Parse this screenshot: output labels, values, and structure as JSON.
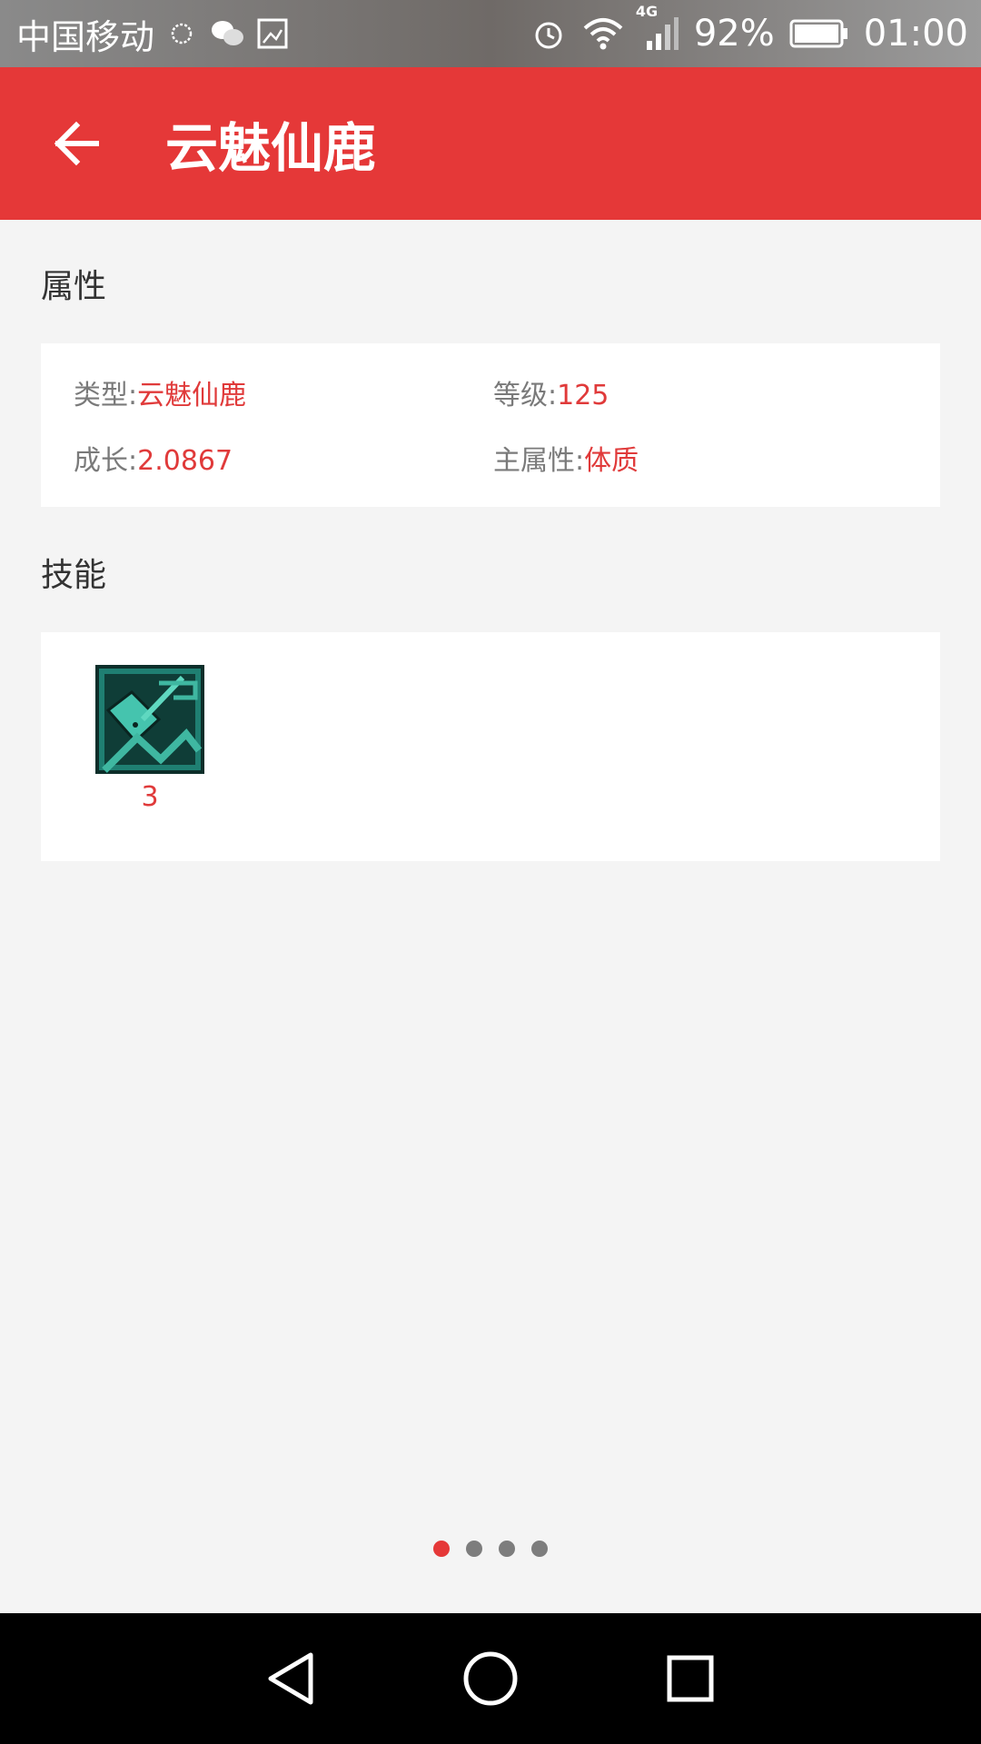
{
  "status_bar": {
    "carrier": "中国移动",
    "network": "4G",
    "battery": "92%",
    "time": "01:00"
  },
  "appbar": {
    "title": "云魅仙鹿"
  },
  "attributes": {
    "section_title": "属性",
    "type_label": "类型:",
    "type_value": "云魅仙鹿",
    "level_label": "等级:",
    "level_value": "125",
    "growth_label": "成长:",
    "growth_value": "2.0867",
    "main_attr_label": "主属性:",
    "main_attr_value": "体质"
  },
  "skills": {
    "section_title": "技能",
    "items": [
      {
        "level": "3",
        "icon": "skill-icon"
      }
    ]
  },
  "pager": {
    "count": 4,
    "active_index": 0
  },
  "colors": {
    "accent": "#e53838",
    "value_text": "#e03a3a"
  }
}
